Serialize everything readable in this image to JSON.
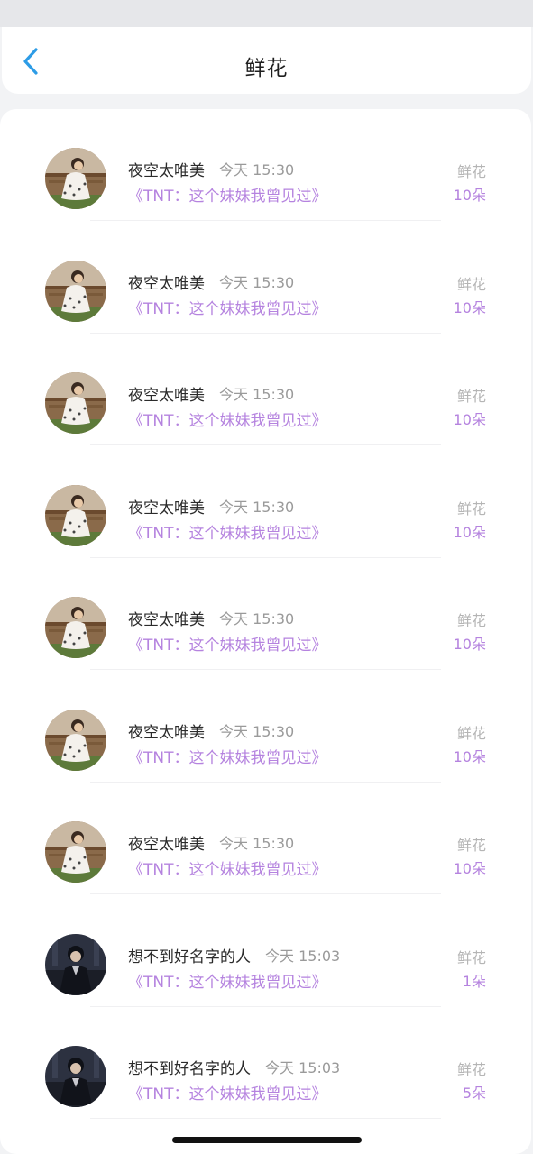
{
  "header": {
    "title": "鲜花",
    "back_icon": "chevron-left-icon",
    "accent_color": "#2d9ce6"
  },
  "list": {
    "name_color": "#2b2b2b",
    "highlight_color": "#b583df",
    "items": [
      {
        "name": "夜空太唯美",
        "time": "今天 15:30",
        "work": "《TNT：这个妹妹我曾见过》",
        "gift": "鲜花",
        "count": "10朵",
        "avatar": "woman-avatar"
      },
      {
        "name": "夜空太唯美",
        "time": "今天 15:30",
        "work": "《TNT：这个妹妹我曾见过》",
        "gift": "鲜花",
        "count": "10朵",
        "avatar": "woman-avatar"
      },
      {
        "name": "夜空太唯美",
        "time": "今天 15:30",
        "work": "《TNT：这个妹妹我曾见过》",
        "gift": "鲜花",
        "count": "10朵",
        "avatar": "woman-avatar"
      },
      {
        "name": "夜空太唯美",
        "time": "今天 15:30",
        "work": "《TNT：这个妹妹我曾见过》",
        "gift": "鲜花",
        "count": "10朵",
        "avatar": "woman-avatar"
      },
      {
        "name": "夜空太唯美",
        "time": "今天 15:30",
        "work": "《TNT：这个妹妹我曾见过》",
        "gift": "鲜花",
        "count": "10朵",
        "avatar": "woman-avatar"
      },
      {
        "name": "夜空太唯美",
        "time": "今天 15:30",
        "work": "《TNT：这个妹妹我曾见过》",
        "gift": "鲜花",
        "count": "10朵",
        "avatar": "woman-avatar"
      },
      {
        "name": "夜空太唯美",
        "time": "今天 15:30",
        "work": "《TNT：这个妹妹我曾见过》",
        "gift": "鲜花",
        "count": "10朵",
        "avatar": "woman-avatar"
      },
      {
        "name": "想不到好名字的人",
        "time": "今天 15:03",
        "work": "《TNT：这个妹妹我曾见过》",
        "gift": "鲜花",
        "count": "1朵",
        "avatar": "man-avatar"
      },
      {
        "name": "想不到好名字的人",
        "time": "今天 15:03",
        "work": "《TNT：这个妹妹我曾见过》",
        "gift": "鲜花",
        "count": "5朵",
        "avatar": "man-avatar"
      }
    ]
  }
}
